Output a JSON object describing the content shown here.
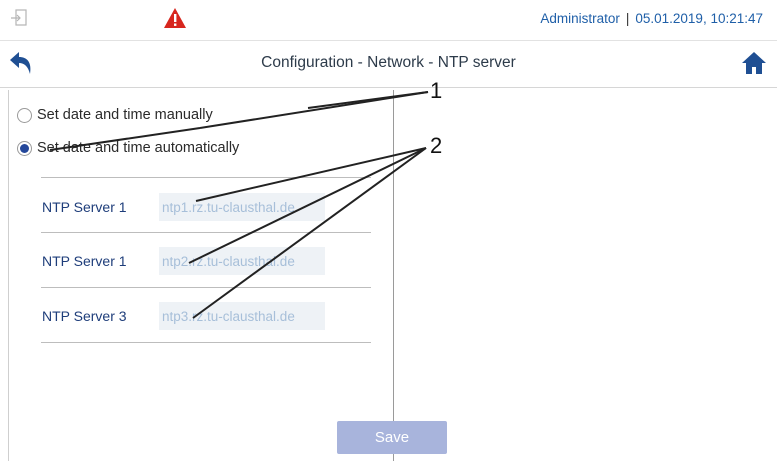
{
  "header": {
    "user": "Administrator",
    "separator": "|",
    "datetime": "05.01.2019, 10:21:47",
    "icons": {
      "logout": "logout-icon",
      "warning": "warning-icon",
      "back": "back-icon",
      "home": "home-icon"
    },
    "colors": {
      "warning": "#d7261e",
      "accent": "#1f4f93",
      "user_text": "#1f5fa8"
    }
  },
  "page": {
    "title": "Configuration - Network - NTP server"
  },
  "time_mode": {
    "options": [
      {
        "label": "Set date and time manually",
        "selected": false
      },
      {
        "label": "Set date and time automatically",
        "selected": true
      }
    ]
  },
  "ntp_servers": [
    {
      "label": "NTP Server 1",
      "value": "ntp1.rz.tu-clausthal.de"
    },
    {
      "label": "NTP Server 1",
      "value": "ntp2.rz.tu-clausthal.de"
    },
    {
      "label": "NTP Server 3",
      "value": "ntp3.rz.tu-clausthal.de"
    }
  ],
  "actions": {
    "save_label": "Save",
    "save_color": "#a8b4dc"
  },
  "callouts": {
    "one": "1",
    "two": "2"
  }
}
